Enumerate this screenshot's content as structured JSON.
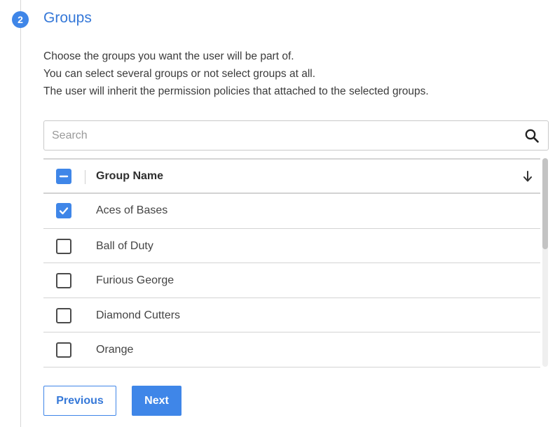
{
  "step": {
    "number": "2",
    "title": "Groups"
  },
  "description": [
    "Choose the groups  you want the user will be part of.",
    "You can select several groups or not select groups at all.",
    "The user will inherit the permission policies that attached to the selected groups."
  ],
  "search": {
    "placeholder": "Search",
    "value": "",
    "icon": "search-icon"
  },
  "table": {
    "header": {
      "select_all_state": "indeterminate",
      "column_label": "Group Name",
      "sort_icon": "arrow-down-icon"
    },
    "rows": [
      {
        "name": "Aces of Bases",
        "checked": true
      },
      {
        "name": "Ball of Duty",
        "checked": false
      },
      {
        "name": "Furious George",
        "checked": false
      },
      {
        "name": "Diamond Cutters",
        "checked": false
      },
      {
        "name": "Orange",
        "checked": false
      }
    ]
  },
  "buttons": {
    "previous_label": "Previous",
    "next_label": "Next"
  },
  "colors": {
    "accent": "#3f86e8",
    "title": "#3578d8"
  }
}
